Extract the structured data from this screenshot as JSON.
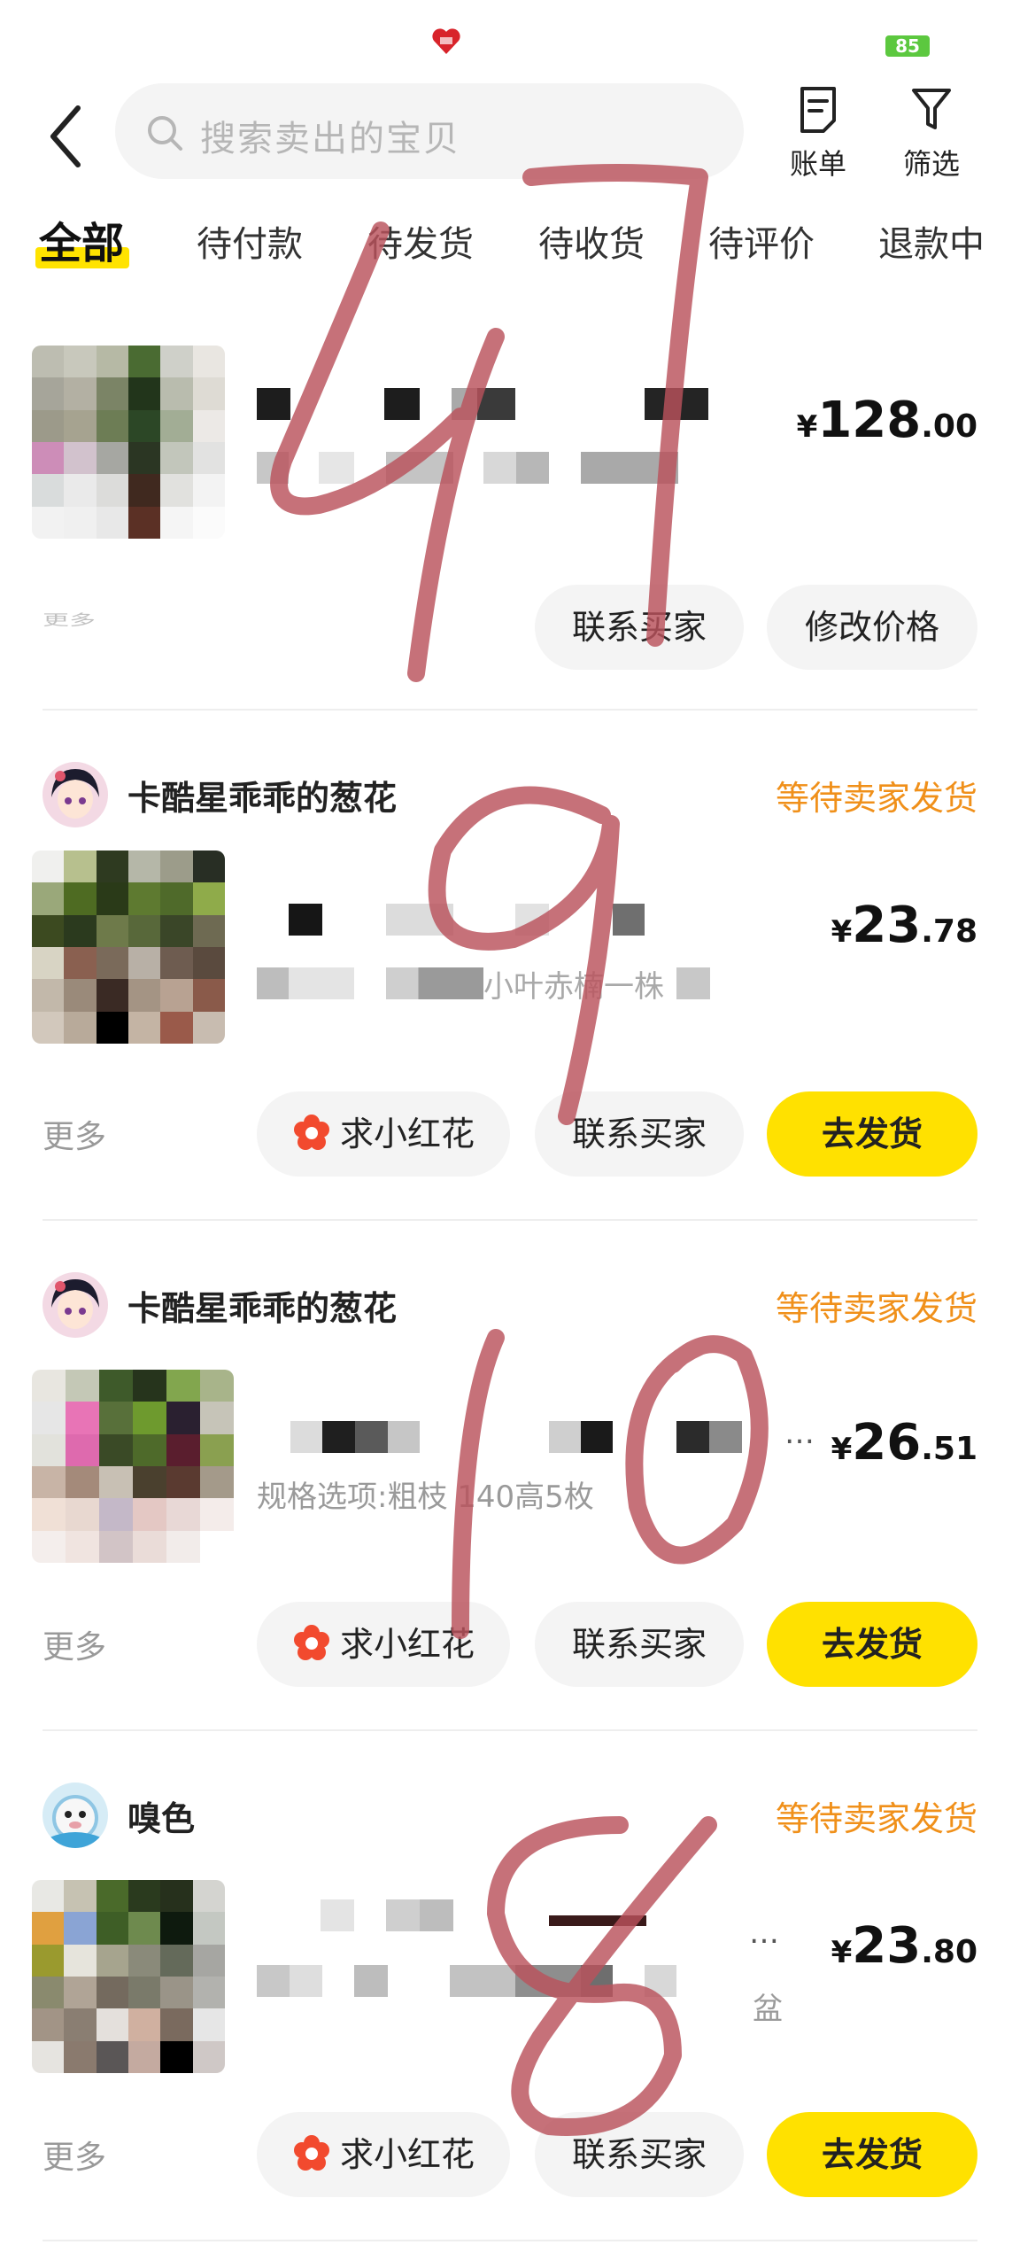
{
  "status_bar": {
    "battery": "85"
  },
  "header": {
    "search_placeholder": "搜索卖出的宝贝",
    "bill_label": "账单",
    "filter_label": "筛选"
  },
  "tabs": [
    {
      "label": "全部",
      "active": true
    },
    {
      "label": "待付款"
    },
    {
      "label": "待发货"
    },
    {
      "label": "待收货"
    },
    {
      "label": "待评价"
    },
    {
      "label": "退款中"
    }
  ],
  "orders": [
    {
      "price_currency": "¥",
      "price_int": "128",
      "price_dec": ".00",
      "more_label": "更多",
      "buttons": [
        "联系买家",
        "修改价格"
      ]
    },
    {
      "shop_name": "卡酷星乖乖的葱花",
      "status": "等待卖家发货",
      "spec": "小叶赤楠一株",
      "price_currency": "¥",
      "price_int": "23",
      "price_dec": ".78",
      "more_label": "更多",
      "buttons": [
        "求小红花",
        "联系买家",
        "去发货"
      ]
    },
    {
      "shop_name": "卡酷星乖乖的葱花",
      "status": "等待卖家发货",
      "spec": "规格选项:粗枝 140高5枚",
      "title_ellipsis": "…",
      "price_currency": "¥",
      "price_int": "26",
      "price_dec": ".51",
      "more_label": "更多",
      "buttons": [
        "求小红花",
        "联系买家",
        "去发货"
      ]
    },
    {
      "shop_name": "嗅色",
      "status": "等待卖家发货",
      "spec": "盆",
      "title_ellipsis": "…",
      "price_currency": "¥",
      "price_int": "23",
      "price_dec": ".80",
      "more_label": "更多",
      "buttons": [
        "求小红花",
        "联系买家",
        "去发货"
      ]
    }
  ],
  "annotations": {
    "color": "#b9525c",
    "numbers": [
      "47",
      "9",
      "10",
      "8"
    ]
  }
}
